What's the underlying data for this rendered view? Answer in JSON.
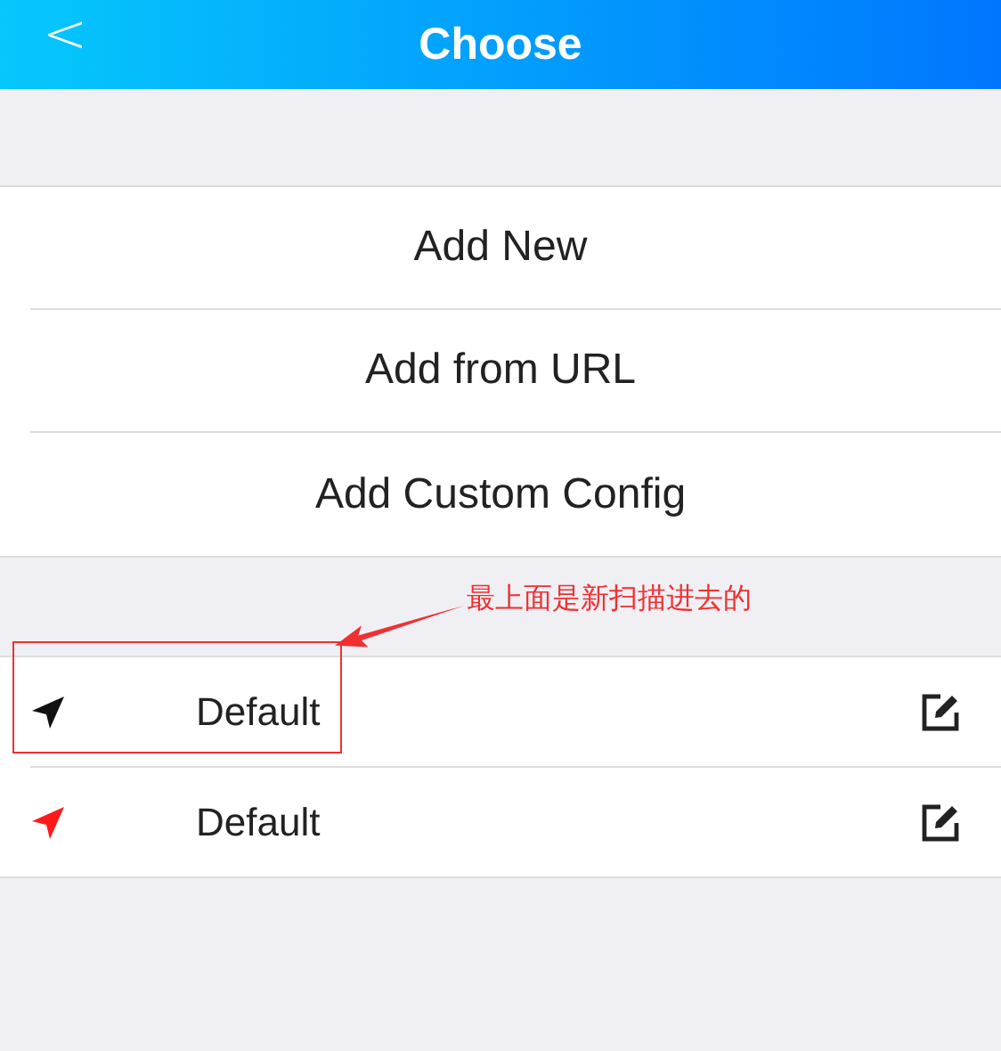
{
  "header": {
    "back": "<",
    "title": "Choose"
  },
  "actions": [
    {
      "label": "Add New"
    },
    {
      "label": "Add from URL"
    },
    {
      "label": "Add Custom Config"
    }
  ],
  "configs": [
    {
      "name": "Default",
      "selected": false
    },
    {
      "name": "Default",
      "selected": true
    }
  ],
  "annotation": {
    "text": "最上面是新扫描进去的"
  }
}
